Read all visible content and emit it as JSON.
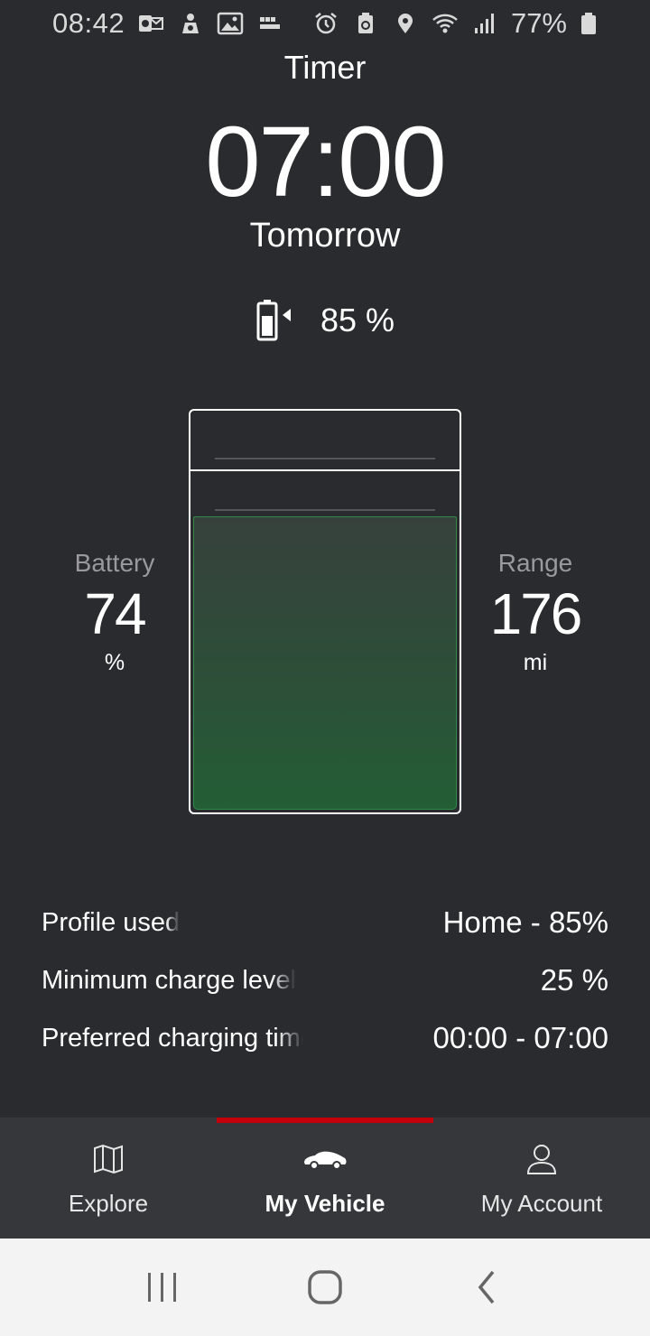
{
  "status_bar": {
    "time": "08:42",
    "battery_pct": "77%",
    "icons_left": [
      "outlook-icon",
      "vpn-icon",
      "gallery-icon",
      "bbc-news-icon"
    ],
    "icons_right": [
      "alarm-icon",
      "recycle-icon",
      "location-icon",
      "wifi-icon",
      "signal-icon",
      "battery-icon"
    ]
  },
  "timer": {
    "title": "Timer",
    "time": "07:00",
    "day": "Tomorrow",
    "target_icon": "battery-charge-target-icon",
    "target_pct": "85 %"
  },
  "gauge": {
    "fill_fraction": 0.74
  },
  "battery": {
    "label": "Battery",
    "value": "74",
    "unit": "%"
  },
  "range": {
    "label": "Range",
    "value": "176",
    "unit": "mi"
  },
  "details": {
    "rows": [
      {
        "label": "Profile used",
        "value": "Home - 85%"
      },
      {
        "label": "Minimum charge level",
        "value": "25 %"
      },
      {
        "label": "Preferred charging time",
        "value": "00:00 - 07:00"
      }
    ]
  },
  "nav": {
    "items": [
      {
        "label": "Explore",
        "icon": "map-icon",
        "active": false
      },
      {
        "label": "My Vehicle",
        "icon": "car-icon",
        "active": true
      },
      {
        "label": "My Account",
        "icon": "user-icon",
        "active": false
      }
    ],
    "indicator_color": "#c4000b"
  },
  "system_nav": {
    "buttons": [
      "recents-icon",
      "home-icon",
      "back-icon"
    ]
  },
  "colors": {
    "background": "#2a2b2f",
    "nav_background": "#36373b",
    "gauge_fill": "#235e35",
    "accent": "#c4000b"
  }
}
